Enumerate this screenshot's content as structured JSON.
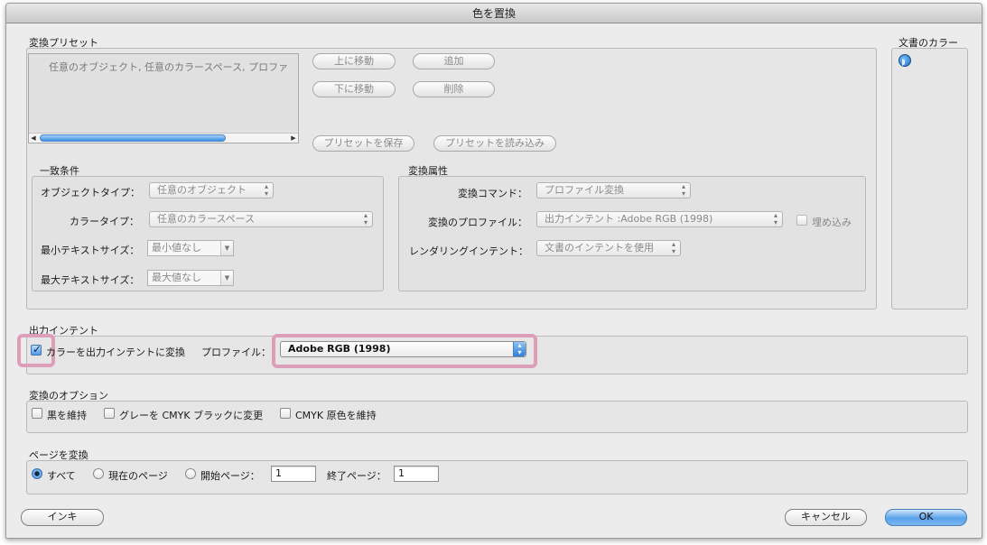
{
  "window": {
    "title": "色を置換"
  },
  "preset": {
    "section_label": "変換プリセット",
    "list_items": [
      "任意のオブジェクト, 任意のカラースペース, プロファ"
    ],
    "buttons": {
      "move_up": "上に移動",
      "add": "追加",
      "move_down": "下に移動",
      "delete": "削除",
      "save": "プリセットを保存",
      "load": "プリセットを読み込み"
    }
  },
  "match": {
    "section_label": "一致条件",
    "object_type_label": "オブジェクトタイプ：",
    "object_type_value": "任意のオブジェクト",
    "color_type_label": "カラータイプ：",
    "color_type_value": "任意のカラースペース",
    "min_text_label": "最小テキストサイズ：",
    "min_text_value": "最小値なし",
    "max_text_label": "最大テキストサイズ：",
    "max_text_value": "最大値なし"
  },
  "convert_attr": {
    "section_label": "変換属性",
    "command_label": "変換コマンド：",
    "command_value": "プロファイル変換",
    "profile_label": "変換のプロファイル：",
    "profile_value": "出力インテント :Adobe RGB (1998)",
    "embed_label": "埋め込み",
    "intent_label": "レンダリングインテント：",
    "intent_value": "文書のインテントを使用"
  },
  "doc_colors": {
    "label": "文書のカラー"
  },
  "output_intent": {
    "section_label": "出力インテント",
    "convert_label": "カラーを出力インテントに変換",
    "convert_checked": true,
    "profile_label": "プロファイル：",
    "profile_value": "Adobe RGB (1998)"
  },
  "convert_options": {
    "section_label": "変換のオプション",
    "keep_black": "黒を維持",
    "gray_to_cmyk_black": "グレーを CMYK ブラックに変更",
    "keep_cmyk_primaries": "CMYK 原色を維持"
  },
  "pages": {
    "section_label": "ページを変換",
    "all": "すべて",
    "current": "現在のページ",
    "start_label": "開始ページ：",
    "start_value": "1",
    "end_label": "終了ページ：",
    "end_value": "1",
    "selected": "all"
  },
  "footer": {
    "ink": "インキ",
    "cancel": "キャンセル",
    "ok": "OK"
  },
  "colors": {
    "highlight": "#dd9fb8",
    "accent": "#3c88db"
  }
}
